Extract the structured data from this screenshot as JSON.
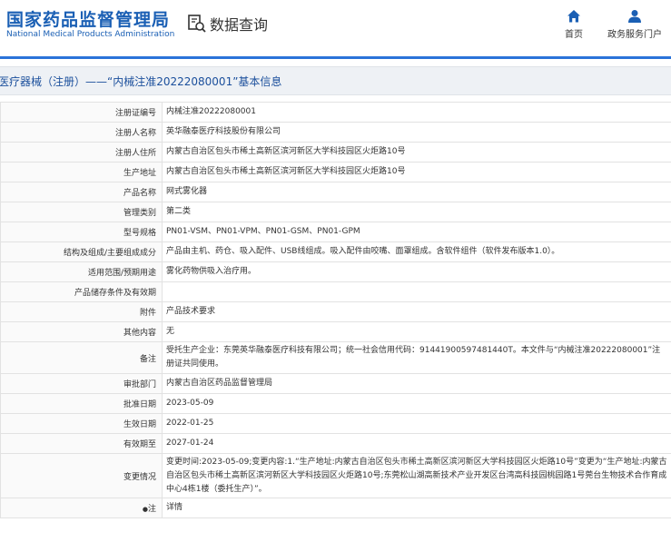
{
  "header": {
    "logo_cn": "国家药品监督管理局",
    "logo_en": "National Medical Products Administration",
    "query_label": "数据查询",
    "nav": [
      {
        "label": "首页",
        "icon": "home-icon"
      },
      {
        "label": "政务服务门户",
        "icon": "user-icon"
      }
    ]
  },
  "title": "医疗器械（注册）——“内械注准20222080001”基本信息",
  "colors": {
    "brand_blue": "#1a5fb4",
    "accent_bar": "#2b73d9",
    "title_text": "#1b4f9c",
    "link": "#2b73d9"
  },
  "rows": [
    {
      "label": "注册证编号",
      "value": "内械注准20222080001"
    },
    {
      "label": "注册人名称",
      "value": "英华融泰医疗科技股份有限公司"
    },
    {
      "label": "注册人住所",
      "value": "内蒙古自治区包头市稀土高新区滨河新区大学科技园区火炬路10号"
    },
    {
      "label": "生产地址",
      "value": "内蒙古自治区包头市稀土高新区滨河新区大学科技园区火炬路10号"
    },
    {
      "label": "产品名称",
      "value": "网式雾化器"
    },
    {
      "label": "管理类别",
      "value": "第二类"
    },
    {
      "label": "型号规格",
      "value": "PN01-VSM、PN01-VPM、PN01-GSM、PN01-GPM"
    },
    {
      "label": "结构及组成/主要组成成分",
      "value": "产品由主机、药仓、吸入配件、USB线组成。吸入配件由咬嘴、面罩组成。含软件组件（软件发布版本1.0）。"
    },
    {
      "label": "适用范围/预期用途",
      "value": "雾化药物供吸入治疗用。"
    },
    {
      "label": "产品储存条件及有效期",
      "value": ""
    },
    {
      "label": "附件",
      "value": "产品技术要求"
    },
    {
      "label": "其他内容",
      "value": "无"
    },
    {
      "label": "备注",
      "value": "受托生产企业：东莞英华融泰医疗科技有限公司；统一社会信用代码：91441900597481440T。本文件与“内械注准20222080001”注册证共同使用。"
    },
    {
      "label": "审批部门",
      "value": "内蒙古自治区药品监督管理局"
    },
    {
      "label": "批准日期",
      "value": "2023-05-09"
    },
    {
      "label": "生效日期",
      "value": "2022-01-25"
    },
    {
      "label": "有效期至",
      "value": "2027-01-24"
    },
    {
      "label": "变更情况",
      "value": "变更时间:2023-05-09;变更内容:1.“生产地址:内蒙古自治区包头市稀土高新区滨河新区大学科技园区火炬路10号”变更为“生产地址:内蒙古自治区包头市稀土高新区滨河新区大学科技园区火炬路10号;东莞松山湖高新技术产业开发区台湾高科技园桃园路1号莞台生物技术合作育成中心4栋1楼（委托生产）”。"
    }
  ],
  "note": {
    "label": "注",
    "value": "详情"
  }
}
